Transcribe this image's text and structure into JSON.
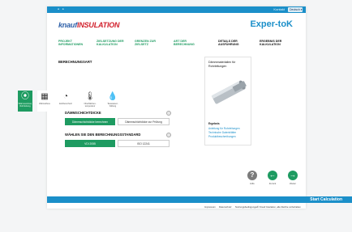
{
  "topbar": {
    "left": "⚬ ⚬",
    "link": "Kontakt",
    "language": "Deutsch ▾"
  },
  "logo": {
    "main": "knauf",
    "accent": "INSULATION"
  },
  "brand": "Exper-toK",
  "steps": [
    {
      "label": "PROJEKT INFORMATIONEN"
    },
    {
      "label": "ZIELSETZUNG DER KALKULATION"
    },
    {
      "label": "GRENZEN ZUR ZIELSETZ"
    },
    {
      "label": "ART DER BERECHNUNG"
    },
    {
      "label": "DETAILS DER AUSFÜHRUNG"
    },
    {
      "label": "ERGEBNIS DER KALKULATION"
    }
  ],
  "section1": {
    "title": "BERECHNUNGSART"
  },
  "tiles": [
    {
      "icon": "pipe-icon",
      "glyph": "⦿",
      "label": "Wärmeverlust, Rohrleitung"
    },
    {
      "icon": "grid-icon",
      "glyph": "▦",
      "label": "Wärmefluss"
    },
    {
      "icon": "gauge-icon",
      "glyph": "◔",
      "label": "Einfrierschutz"
    },
    {
      "icon": "temperature-icon",
      "glyph": "🌡",
      "label": "Oberflächen-temperatur"
    },
    {
      "icon": "drop-icon",
      "glyph": "💧",
      "label": "Tauwasser-bildung"
    }
  ],
  "section2": {
    "title": "DÄMMSCHICHTDICKE",
    "options": [
      "Dämmschichtdicke berechnen",
      "Dämmschichtdicke zur Prüfung"
    ]
  },
  "section3": {
    "title": "WÄHLEN SIE DEN BERECHNUNGSSTANDARD",
    "options": [
      "VDI 2055",
      "ISO 12241"
    ]
  },
  "side": {
    "title": "Dämmmaterialien für Rohrleitungen",
    "head": "Ergebnis",
    "links": [
      "Anleitung für Rohrleitungen",
      "Technische Datenblätter",
      "Produktbeschreibungen"
    ]
  },
  "nav": {
    "help": "Hilfe",
    "back": "Zurück",
    "next": "Weiter"
  },
  "cta": {
    "label": "Start Calculation"
  },
  "footer": [
    "Impressum",
    "Datenschutz",
    "Nutzungsbedingungen",
    "© Knauf Insulation, alle Rechte vorbehalten"
  ],
  "colors": {
    "accent_blue": "#1b8fc9",
    "accent_green": "#1e9b61",
    "logo_blue": "#2b5ea7",
    "logo_red": "#d11e2a"
  }
}
